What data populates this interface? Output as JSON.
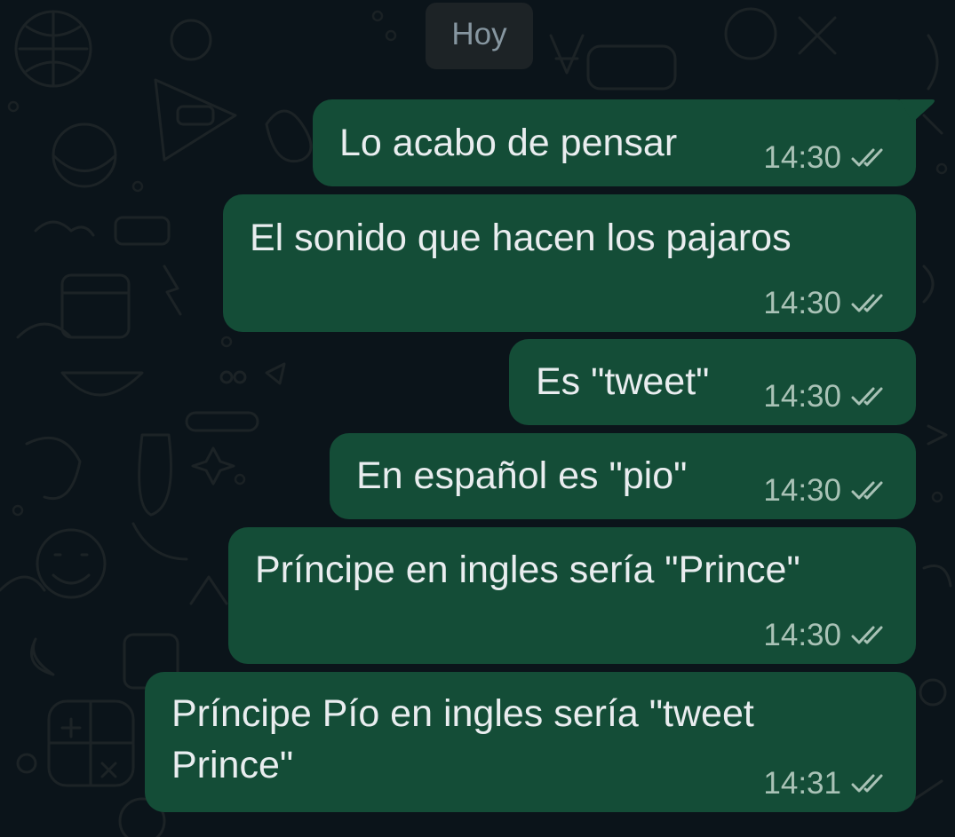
{
  "date_separator": "Hoy",
  "messages": [
    {
      "text": "Lo acabo de pensar",
      "time": "14:30",
      "status": "read-double-check-icon"
    },
    {
      "text": "El sonido que hacen los pajaros",
      "time": "14:30",
      "status": "read-double-check-icon"
    },
    {
      "text": "Es \"tweet\"",
      "time": "14:30",
      "status": "read-double-check-icon"
    },
    {
      "text": "En español es \"pio\"",
      "time": "14:30",
      "status": "read-double-check-icon"
    },
    {
      "text": "Príncipe en ingles sería \"Prince\"",
      "time": "14:30",
      "status": "read-double-check-icon"
    },
    {
      "text_line1": "Príncipe Pío en ingles sería \"tweet",
      "text_line2": "Prince\"",
      "time": "14:31",
      "status": "read-double-check-icon"
    }
  ],
  "colors": {
    "background": "#0b141a",
    "outgoing_bubble": "#144d37",
    "date_chip": "#1d2326",
    "date_text": "#8696a0",
    "message_text": "#e9edef",
    "meta_text": "#a9c2b6"
  }
}
